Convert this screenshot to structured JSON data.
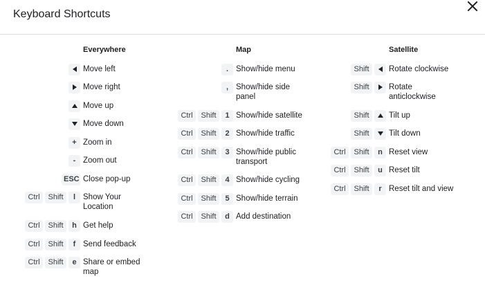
{
  "dialog": {
    "title": "Keyboard Shortcuts",
    "close_icon": "close-icon"
  },
  "columns": [
    {
      "heading": "Everywhere",
      "shortcuts": [
        {
          "keys": [
            {
              "icon": "arrow-left-icon"
            }
          ],
          "label": "Move left"
        },
        {
          "keys": [
            {
              "icon": "arrow-right-icon"
            }
          ],
          "label": "Move right"
        },
        {
          "keys": [
            {
              "icon": "arrow-up-icon"
            }
          ],
          "label": "Move up"
        },
        {
          "keys": [
            {
              "icon": "arrow-down-icon"
            }
          ],
          "label": "Move down"
        },
        {
          "keys": [
            {
              "text": "+"
            }
          ],
          "label": "Zoom in"
        },
        {
          "keys": [
            {
              "text": "-"
            }
          ],
          "label": "Zoom out"
        },
        {
          "keys": [
            {
              "text": "ESC"
            }
          ],
          "label": "Close pop-up"
        },
        {
          "keys": [
            {
              "text": "Ctrl"
            },
            {
              "text": "Shift"
            },
            {
              "text": "l"
            }
          ],
          "label": "Show Your\nLocation"
        },
        {
          "keys": [
            {
              "text": "Ctrl"
            },
            {
              "text": "Shift"
            },
            {
              "text": "h"
            }
          ],
          "label": "Get help"
        },
        {
          "keys": [
            {
              "text": "Ctrl"
            },
            {
              "text": "Shift"
            },
            {
              "text": "f"
            }
          ],
          "label": "Send feedback"
        },
        {
          "keys": [
            {
              "text": "Ctrl"
            },
            {
              "text": "Shift"
            },
            {
              "text": "e"
            }
          ],
          "label": "Share or embed\nmap"
        }
      ]
    },
    {
      "heading": "Map",
      "shortcuts": [
        {
          "keys": [
            {
              "text": "."
            }
          ],
          "label": "Show/hide menu"
        },
        {
          "keys": [
            {
              "text": ","
            }
          ],
          "label": "Show/hide side\npanel"
        },
        {
          "keys": [
            {
              "text": "Ctrl"
            },
            {
              "text": "Shift"
            },
            {
              "text": "1"
            }
          ],
          "label": "Show/hide satellite"
        },
        {
          "keys": [
            {
              "text": "Ctrl"
            },
            {
              "text": "Shift"
            },
            {
              "text": "2"
            }
          ],
          "label": "Show/hide traffic"
        },
        {
          "keys": [
            {
              "text": "Ctrl"
            },
            {
              "text": "Shift"
            },
            {
              "text": "3"
            }
          ],
          "label": "Show/hide public\ntransport"
        },
        {
          "keys": [
            {
              "text": "Ctrl"
            },
            {
              "text": "Shift"
            },
            {
              "text": "4"
            }
          ],
          "label": "Show/hide cycling"
        },
        {
          "keys": [
            {
              "text": "Ctrl"
            },
            {
              "text": "Shift"
            },
            {
              "text": "5"
            }
          ],
          "label": "Show/hide terrain"
        },
        {
          "keys": [
            {
              "text": "Ctrl"
            },
            {
              "text": "Shift"
            },
            {
              "text": "d"
            }
          ],
          "label": "Add destination"
        }
      ]
    },
    {
      "heading": "Satellite",
      "shortcuts": [
        {
          "keys": [
            {
              "text": "Shift"
            },
            {
              "icon": "arrow-left-icon"
            }
          ],
          "label": "Rotate clockwise"
        },
        {
          "keys": [
            {
              "text": "Shift"
            },
            {
              "icon": "arrow-right-icon"
            }
          ],
          "label": "Rotate\nanticlockwise"
        },
        {
          "keys": [
            {
              "text": "Shift"
            },
            {
              "icon": "arrow-up-icon"
            }
          ],
          "label": "Tilt up"
        },
        {
          "keys": [
            {
              "text": "Shift"
            },
            {
              "icon": "arrow-down-icon"
            }
          ],
          "label": "Tilt down"
        },
        {
          "keys": [
            {
              "text": "Ctrl"
            },
            {
              "text": "Shift"
            },
            {
              "text": "n"
            }
          ],
          "label": "Reset view"
        },
        {
          "keys": [
            {
              "text": "Ctrl"
            },
            {
              "text": "Shift"
            },
            {
              "text": "u"
            }
          ],
          "label": "Reset tilt"
        },
        {
          "keys": [
            {
              "text": "Ctrl"
            },
            {
              "text": "Shift"
            },
            {
              "text": "r"
            }
          ],
          "label": "Reset tilt and view"
        }
      ]
    }
  ]
}
